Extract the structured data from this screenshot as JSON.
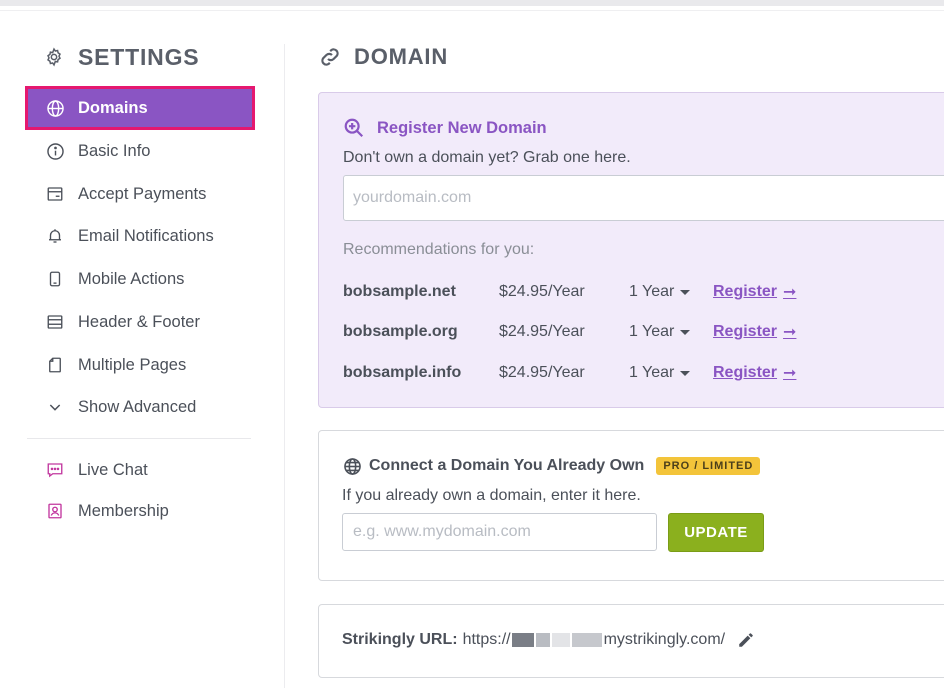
{
  "sidebar": {
    "title": "SETTINGS",
    "items": [
      {
        "label": "Domains",
        "icon": "globe-icon",
        "active": true
      },
      {
        "label": "Basic Info",
        "icon": "info-icon"
      },
      {
        "label": "Accept Payments",
        "icon": "payment-card-icon"
      },
      {
        "label": "Email Notifications",
        "icon": "bell-icon"
      },
      {
        "label": "Mobile Actions",
        "icon": "mobile-icon"
      },
      {
        "label": "Header & Footer",
        "icon": "header-footer-icon"
      },
      {
        "label": "Multiple Pages",
        "icon": "pages-icon"
      },
      {
        "label": "Show Advanced",
        "icon": "chevron-down-icon"
      }
    ],
    "extras": [
      {
        "label": "Live Chat",
        "icon": "chat-icon"
      },
      {
        "label": "Membership",
        "icon": "membership-icon"
      }
    ]
  },
  "main": {
    "title": "DOMAIN",
    "register": {
      "title": "Register New Domain",
      "subtitle": "Don't own a domain yet? Grab one here.",
      "placeholder": "yourdomain.com",
      "recommendations_label": "Recommendations for you:",
      "recommendations": [
        {
          "domain": "bobsample.net",
          "price": "$24.95/Year",
          "period": "1 Year",
          "action": "Register"
        },
        {
          "domain": "bobsample.org",
          "price": "$24.95/Year",
          "period": "1 Year",
          "action": "Register"
        },
        {
          "domain": "bobsample.info",
          "price": "$24.95/Year",
          "period": "1 Year",
          "action": "Register"
        }
      ]
    },
    "connect": {
      "title": "Connect a Domain You Already Own",
      "badge": "PRO / LIMITED",
      "subtitle": "If you already own a domain, enter it here.",
      "placeholder": "e.g. www.mydomain.com",
      "button": "UPDATE"
    },
    "strikingly_url": {
      "label": "Strikingly URL:",
      "prefix": "https://",
      "suffix": "mystrikingly.com/"
    }
  },
  "colors": {
    "accent": "#8a55c3",
    "highlight": "#e5186f",
    "register_bg": "#f2ebfa",
    "badge": "#f3c43a",
    "update_button": "#8bb01e"
  }
}
